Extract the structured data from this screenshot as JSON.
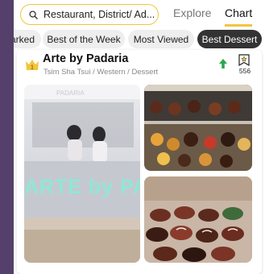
{
  "search": {
    "text": "Restaurant, District/ Ad..."
  },
  "tabs": [
    {
      "label": "Explore"
    },
    {
      "label": "Chart"
    }
  ],
  "chips": [
    {
      "label": "Bookmarked",
      "visible": "arked"
    },
    {
      "label": "Best of the Week"
    },
    {
      "label": "Most Viewed"
    },
    {
      "label": "Best Dessert"
    }
  ],
  "restaurant": {
    "rank": "1",
    "name": "Arte by Padaria",
    "location": "Tsim Sha Tsui / Western / Dessert",
    "bookmark_count": "556",
    "trend": "up"
  },
  "photos": {
    "main_sign": "ARTE by PADAR",
    "store_sign": "PADARIA"
  },
  "colors": {
    "accent": "#f2c53d",
    "trend_up": "#2aa84a",
    "backdrop": "#54406a"
  }
}
